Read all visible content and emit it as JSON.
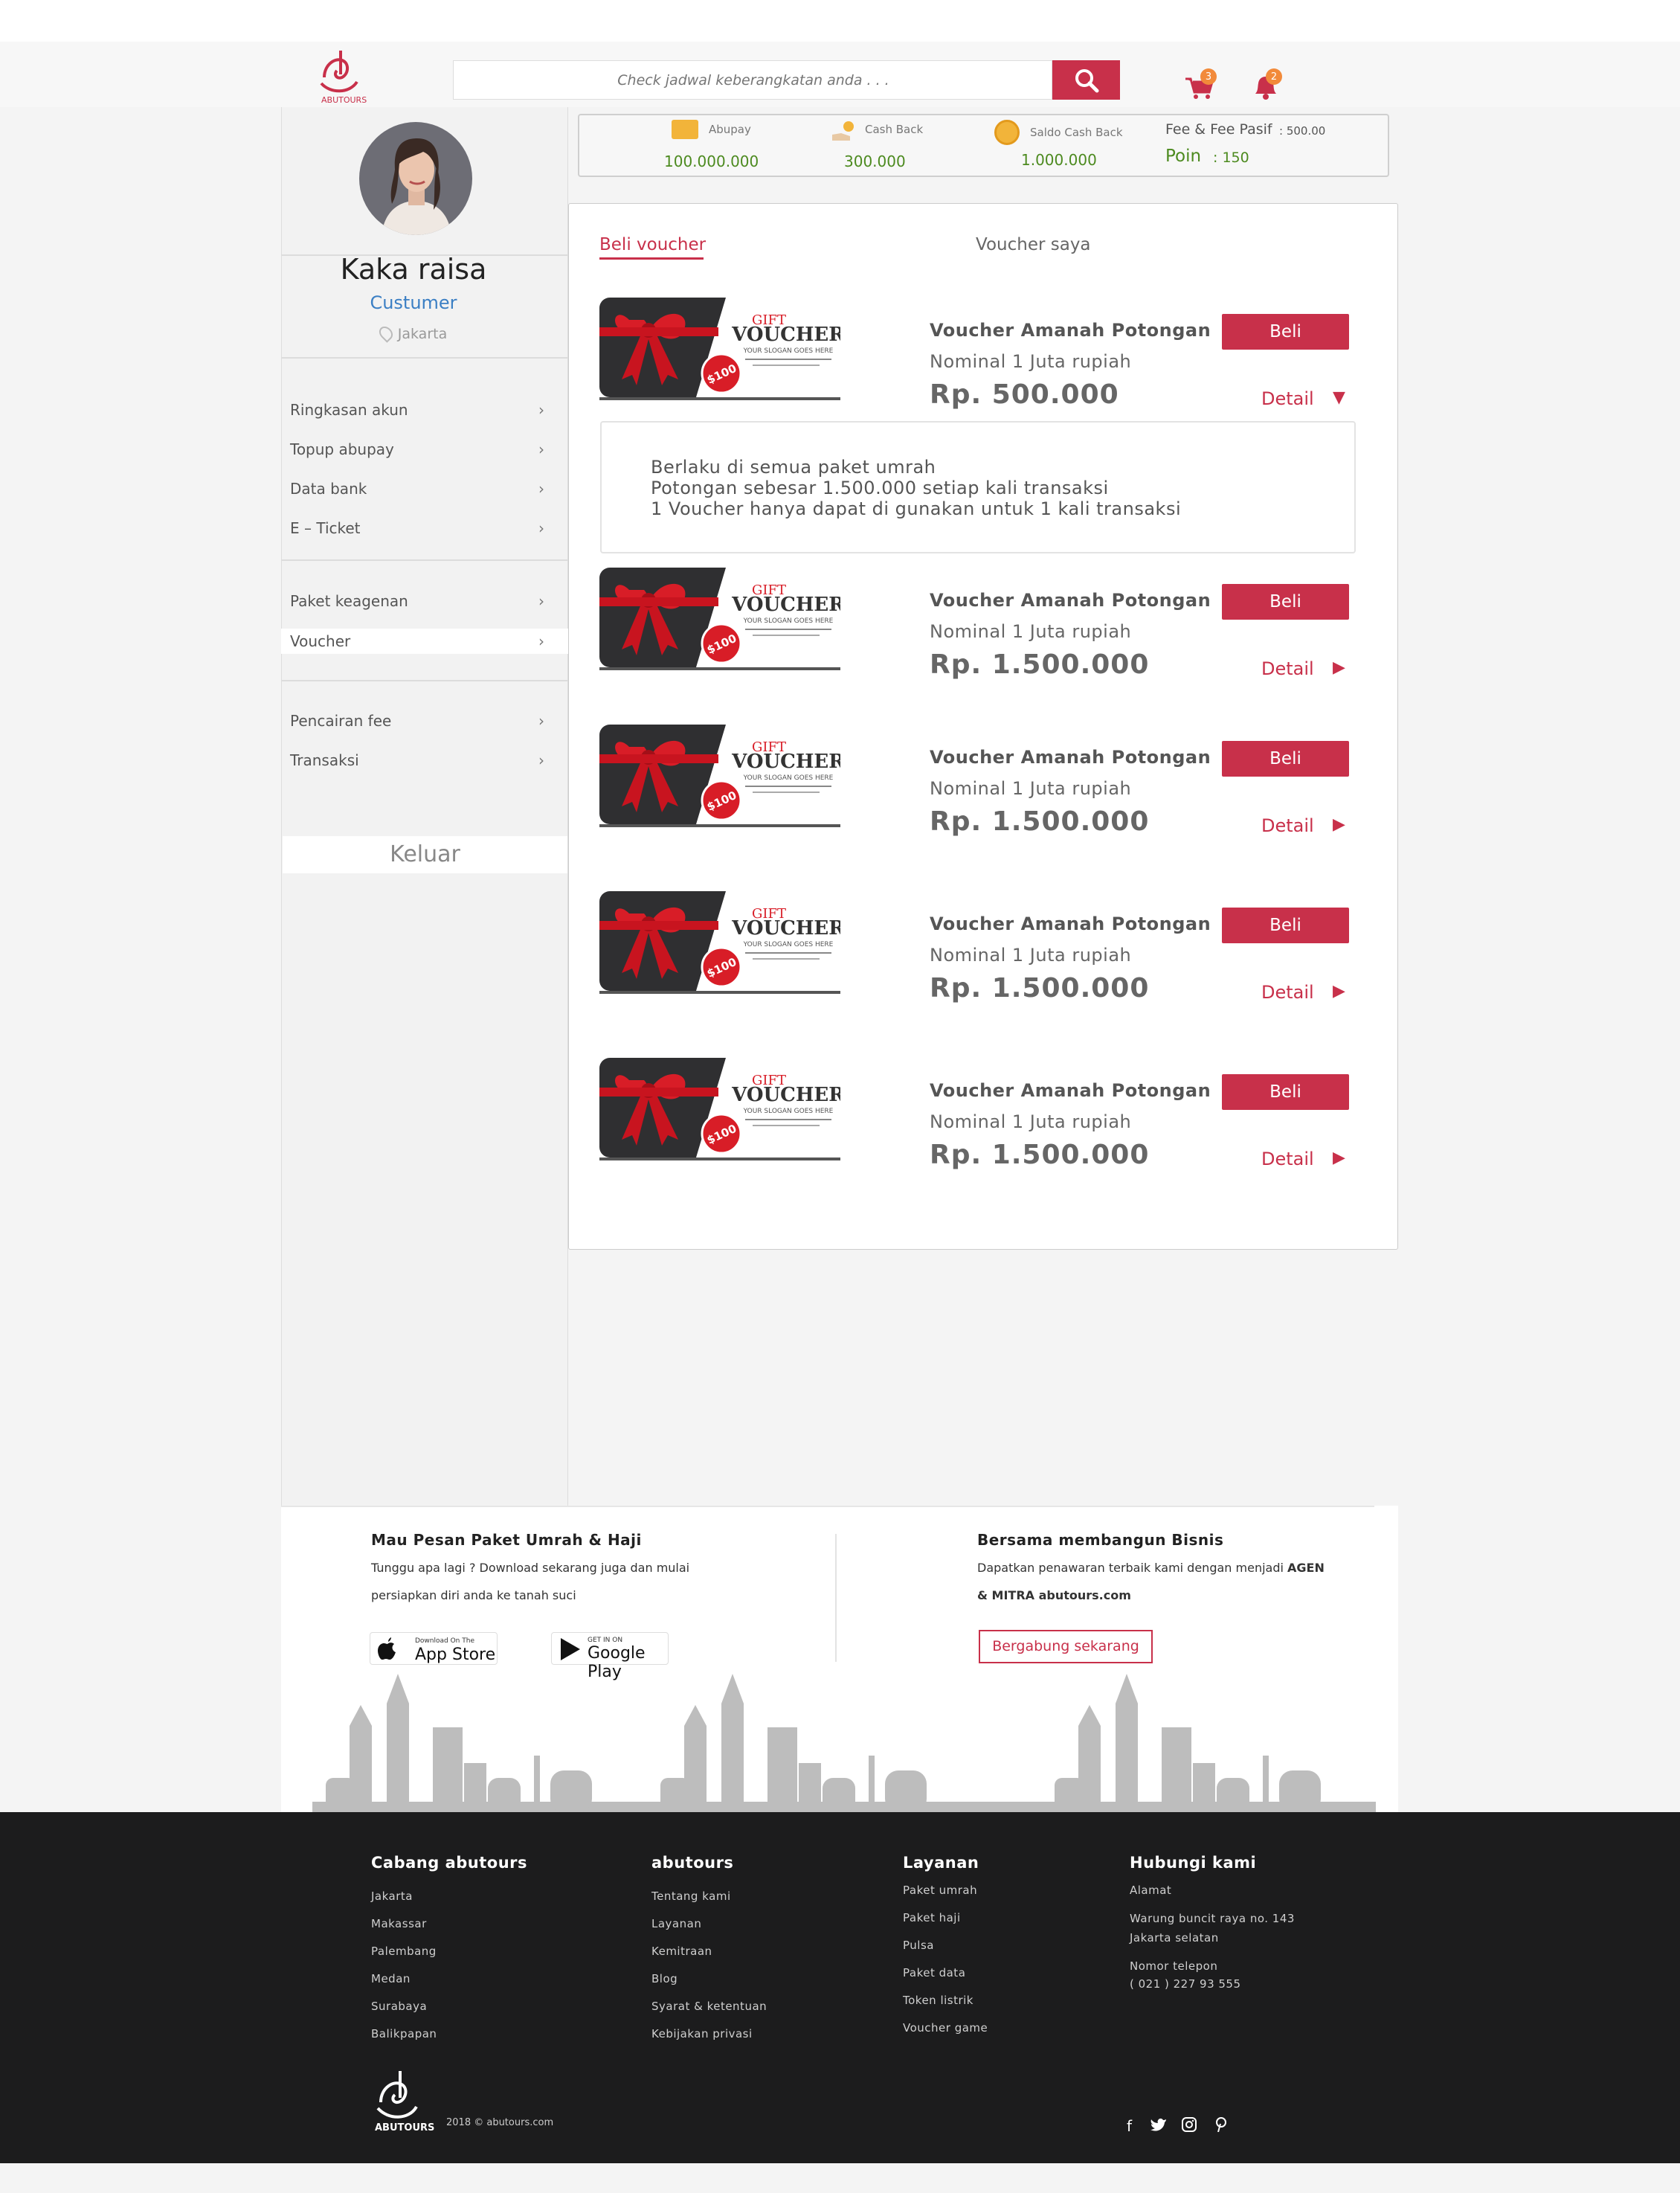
{
  "header": {
    "search_placeholder": "Check jadwal keberangkatan anda . . .",
    "cart_count": "3",
    "notif_count": "2",
    "logo_text": "ABUTOURS"
  },
  "profile": {
    "name": "Kaka raisa",
    "role": "Custumer",
    "city": "Jakarta"
  },
  "menu": {
    "group1": [
      "Ringkasan akun",
      "Topup abupay",
      "Data bank",
      "E – Ticket"
    ],
    "group2": [
      "Paket keagenan",
      "Voucher"
    ],
    "group3": [
      "Pencairan fee",
      "Transaksi"
    ],
    "logout": "Keluar"
  },
  "wallet": {
    "abupay_label": "Abupay",
    "abupay_value": "100.000.000",
    "cashback_label": "Cash Back",
    "cashback_value": "300.000",
    "saldo_label": "Saldo Cash Back",
    "saldo_value": "1.000.000",
    "fee_label": "Fee & Fee Pasif",
    "fee_value": ": 500.00",
    "poin_label": "Poin",
    "poin_value": ": 150"
  },
  "tabs": {
    "beli": "Beli voucher",
    "saya": "Voucher saya"
  },
  "voucher_image": {
    "gift": "GIFT",
    "voucher": "VOUCHER",
    "slogan": "YOUR SLOGAN GOES HERE",
    "amount": "$100"
  },
  "vouchers": [
    {
      "title": "Voucher Amanah Potongan",
      "sub": "Nominal 1 Juta rupiah",
      "price": "Rp. 500.000",
      "buy": "Beli",
      "detail": "Detail",
      "arrow": "▼"
    },
    {
      "title": "Voucher Amanah Potongan",
      "sub": "Nominal 1 Juta rupiah",
      "price": "Rp. 1.500.000",
      "buy": "Beli",
      "detail": "Detail",
      "arrow": "▶"
    },
    {
      "title": "Voucher Amanah Potongan",
      "sub": "Nominal 1 Juta rupiah",
      "price": "Rp. 1.500.000",
      "buy": "Beli",
      "detail": "Detail",
      "arrow": "▶"
    },
    {
      "title": "Voucher Amanah Potongan",
      "sub": "Nominal 1 Juta rupiah",
      "price": "Rp. 1.500.000",
      "buy": "Beli",
      "detail": "Detail",
      "arrow": "▶"
    },
    {
      "title": "Voucher Amanah Potongan",
      "sub": "Nominal 1 Juta rupiah",
      "price": "Rp. 1.500.000",
      "buy": "Beli",
      "detail": "Detail",
      "arrow": "▶"
    }
  ],
  "detail_lines": [
    "Berlaku di semua paket umrah",
    "Potongan sebesar 1.500.000 setiap kali transaksi",
    "1 Voucher hanya dapat di gunakan untuk 1 kali transaksi"
  ],
  "promo": {
    "left_title": "Mau Pesan Paket Umrah & Haji",
    "left_line1": "Tunggu apa lagi ? Download sekarang juga dan mulai",
    "left_line2": "persiapkan diri anda ke tanah suci",
    "appstore_small": "Download On The",
    "appstore_big": "App Store",
    "gplay_small": "GET IN ON",
    "gplay_big": "Google Play",
    "right_title": "Bersama membangun Bisnis",
    "right_line1_a": "Dapatkan penawaran terbaik kami dengan menjadi ",
    "right_line1_b": "AGEN",
    "right_line2": "& MITRA abutours.com",
    "join": "Bergabung sekarang"
  },
  "footer": {
    "col1_title": "Cabang abutours",
    "col1": [
      "Jakarta",
      "Makassar",
      "Palembang",
      "Medan",
      "Surabaya",
      "Balikpapan"
    ],
    "col2_title": "abutours",
    "col2": [
      "Tentang kami",
      "Layanan",
      "Kemitraan",
      "Blog",
      "Syarat & ketentuan",
      "Kebijakan privasi"
    ],
    "col3_title": "Layanan",
    "col3": [
      "Paket umrah",
      "Paket haji",
      "Pulsa",
      "Paket data",
      "Token listrik",
      "Voucher game"
    ],
    "col4_title": "Hubungi kami",
    "address_label": "Alamat",
    "address_1": "Warung buncit raya no. 143",
    "address_2": "Jakarta selatan",
    "phone_label": "Nomor telepon",
    "phone": "( 021 )  227 93 555",
    "copyright": "2018 © abutours.com",
    "social": [
      "facebook-icon",
      "twitter-icon",
      "instagram-icon",
      "pinterest-icon"
    ]
  },
  "colors": {
    "accent": "#c8304a",
    "money": "#4c8a1f",
    "link": "#3b7fc4",
    "footer": "#1c1c1d"
  }
}
